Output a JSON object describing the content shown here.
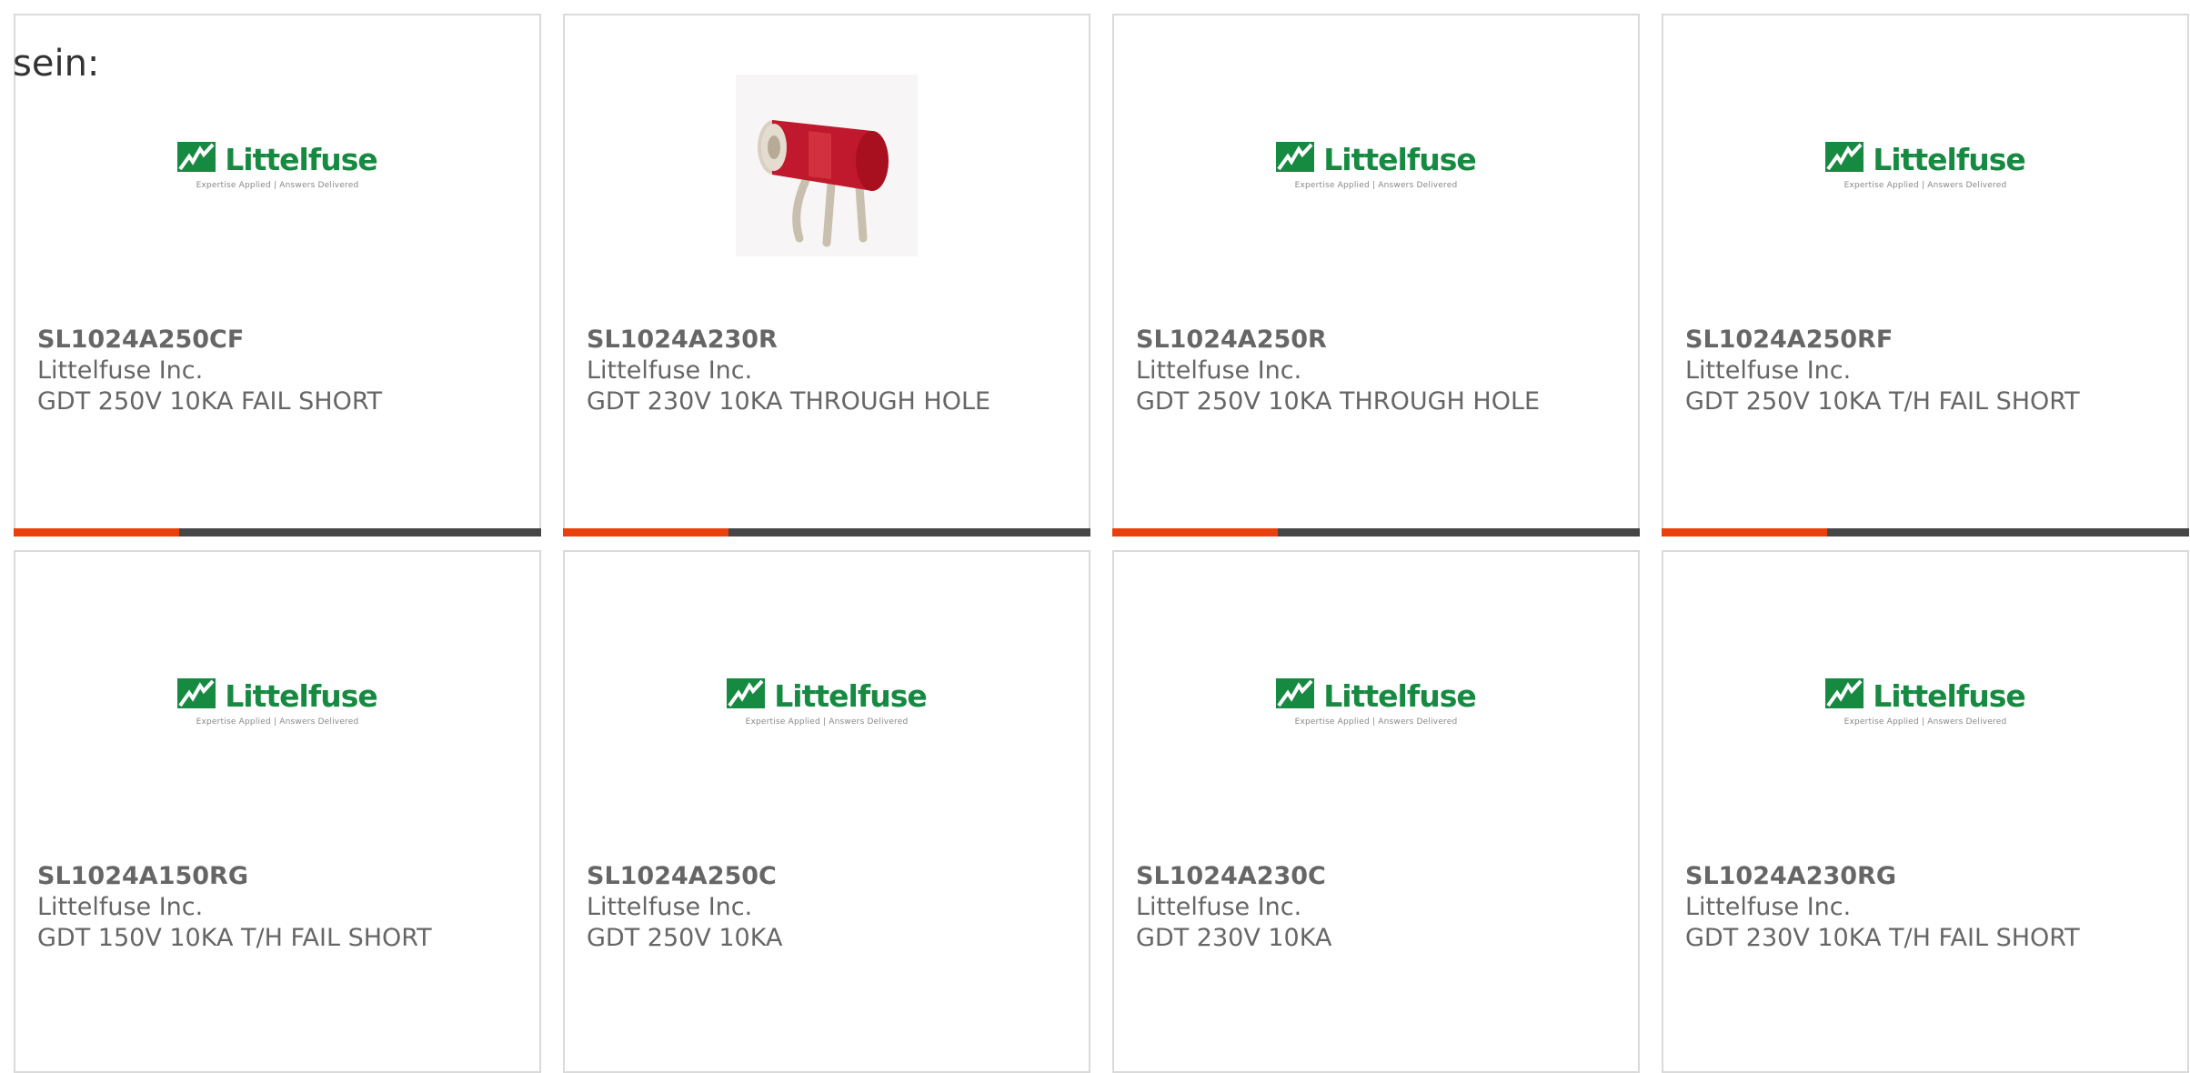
{
  "intro_text": "sein:",
  "logo": {
    "word": "Littelfuse",
    "tagline": "Expertise Applied | Answers Delivered"
  },
  "colors": {
    "brand_green": "#178a42",
    "accent_orange": "#e8410d",
    "bar_dark": "#464646",
    "text_gray": "#666666",
    "border": "#dadada"
  },
  "products": [
    {
      "part_number": "SL1024A250CF",
      "manufacturer": "Littelfuse Inc.",
      "description": "GDT 250V 10KA FAIL SHORT",
      "image": "littelfuse-logo",
      "has_bar": true
    },
    {
      "part_number": "SL1024A230R",
      "manufacturer": "Littelfuse Inc.",
      "description": "GDT 230V 10KA THROUGH HOLE",
      "image": "gdt-component-photo",
      "has_bar": true
    },
    {
      "part_number": "SL1024A250R",
      "manufacturer": "Littelfuse Inc.",
      "description": "GDT 250V 10KA THROUGH HOLE",
      "image": "littelfuse-logo",
      "has_bar": true
    },
    {
      "part_number": "SL1024A250RF",
      "manufacturer": "Littelfuse Inc.",
      "description": "GDT 250V 10KA T/H FAIL SHORT",
      "image": "littelfuse-logo",
      "has_bar": true
    },
    {
      "part_number": "SL1024A150RG",
      "manufacturer": "Littelfuse Inc.",
      "description": "GDT 150V 10KA T/H FAIL SHORT",
      "image": "littelfuse-logo",
      "has_bar": false
    },
    {
      "part_number": "SL1024A250C",
      "manufacturer": "Littelfuse Inc.",
      "description": "GDT 250V 10KA",
      "image": "littelfuse-logo",
      "has_bar": false
    },
    {
      "part_number": "SL1024A230C",
      "manufacturer": "Littelfuse Inc.",
      "description": "GDT 230V 10KA",
      "image": "littelfuse-logo",
      "has_bar": false
    },
    {
      "part_number": "SL1024A230RG",
      "manufacturer": "Littelfuse Inc.",
      "description": "GDT 230V 10KA T/H FAIL SHORT",
      "image": "littelfuse-logo",
      "has_bar": false
    }
  ]
}
